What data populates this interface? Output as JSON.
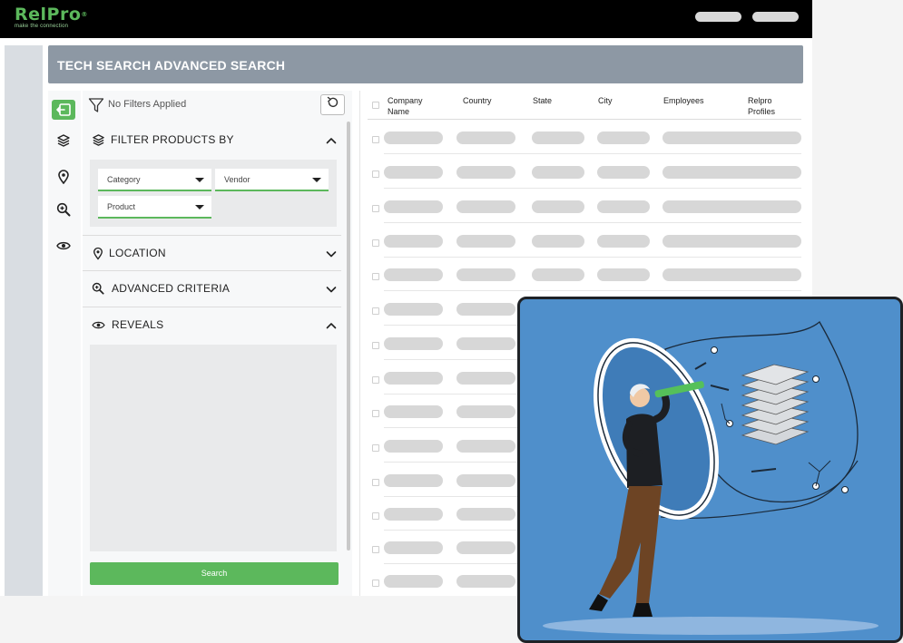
{
  "topbar": {
    "brand": "RelPro",
    "brand_mark": "®",
    "tagline": "make the connection"
  },
  "header": {
    "title": "TECH SEARCH ADVANCED SEARCH"
  },
  "filter_panel": {
    "status": "No Filters Applied",
    "sections": {
      "filter_products": "FILTER PRODUCTS BY",
      "location": "LOCATION",
      "advanced_criteria": "ADVANCED CRITERIA",
      "reveals": "REVEALS"
    },
    "dropdowns": {
      "category": "Category",
      "vendor": "Vendor",
      "product": "Product"
    },
    "search_label": "Search"
  },
  "table": {
    "columns": {
      "company": "Company Name",
      "country": "Country",
      "state": "State",
      "city": "City",
      "employees": "Employees",
      "relpro_profiles": "Relpro Profiles"
    },
    "company_header": [
      "Company",
      "Name"
    ],
    "profiles_header": [
      "Relpro",
      "Profiles"
    ]
  },
  "colors": {
    "accent": "#5cb85c",
    "header_band": "#8d98a4",
    "illustration_bg": "#4f8fcb",
    "placeholder": "#d7d7d7"
  },
  "icons": {
    "nav": [
      "exit-icon",
      "layers-icon",
      "map-pin-icon",
      "zoom-in-icon",
      "eye-icon"
    ],
    "panel": [
      "filter-icon",
      "reset-icon",
      "chevron-up-icon",
      "chevron-down-icon"
    ]
  }
}
